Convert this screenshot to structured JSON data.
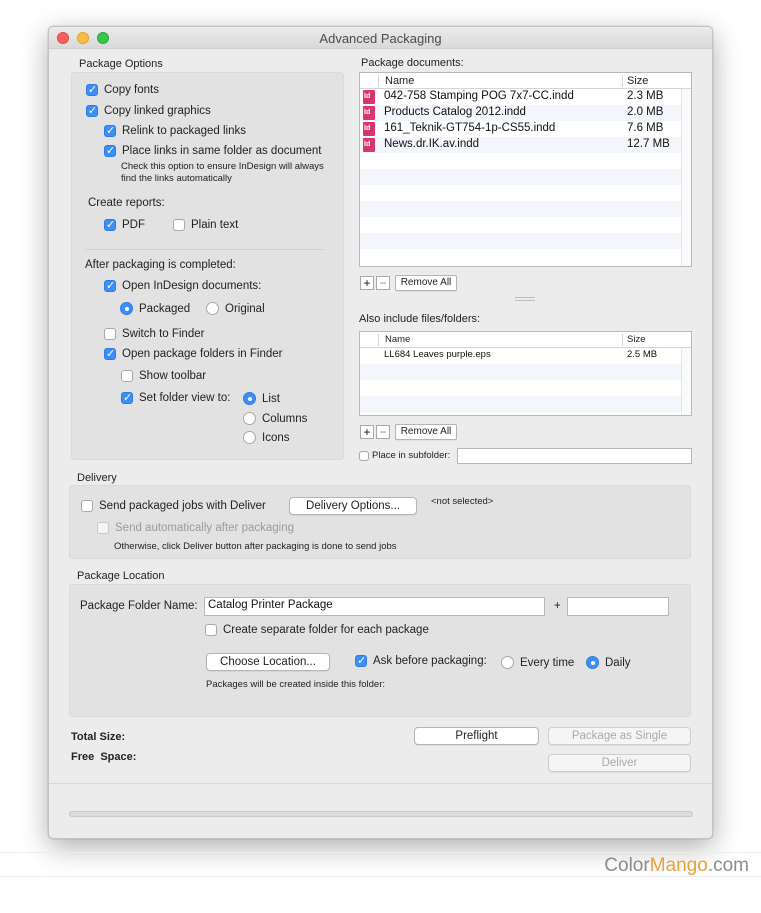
{
  "window": {
    "title": "Advanced Packaging"
  },
  "package_options": {
    "title": "Package Options",
    "copy_fonts": "Copy fonts",
    "copy_linked_graphics": "Copy linked graphics",
    "relink": "Relink to packaged links",
    "place_links": "Place links in same folder as document",
    "place_links_hint": "Check this option to ensure InDesign will always find the links automatically",
    "create_reports": "Create reports:",
    "pdf": "PDF",
    "plain_text": "Plain text",
    "after_packaging": "After packaging is completed:",
    "open_indesign_docs": "Open InDesign documents:",
    "packaged": "Packaged",
    "original": "Original",
    "switch_to_finder": "Switch to Finder",
    "open_package_folders": "Open package folders in Finder",
    "show_toolbar": "Show toolbar",
    "set_folder_view": "Set folder view to:",
    "view_list": "List",
    "view_columns": "Columns",
    "view_icons": "Icons"
  },
  "package_documents": {
    "title": "Package documents:",
    "col_name": "Name",
    "col_size": "Size",
    "rows": [
      {
        "name": "042-758 Stamping POG 7x7-CC.indd",
        "size": "2.3 MB"
      },
      {
        "name": "Products Catalog 2012.indd",
        "size": "2.0 MB"
      },
      {
        "name": "161_Teknik-GT754-1p-CS55.indd",
        "size": "7.6 MB"
      },
      {
        "name": "News.dr.IK.av.indd",
        "size": "12.7 MB"
      }
    ],
    "add_label": "+",
    "remove_label": "−",
    "remove_all": "Remove All"
  },
  "also_include": {
    "title": "Also include files/folders:",
    "col_name": "Name",
    "col_size": "Size",
    "rows": [
      {
        "name": "LL684 Leaves purple.eps",
        "size": "2.5 MB"
      }
    ],
    "add_label": "+",
    "remove_label": "−",
    "remove_all": "Remove All",
    "place_in_subfolder": "Place in subfolder:",
    "subfolder_value": ""
  },
  "delivery": {
    "title": "Delivery",
    "send_with_deliver": "Send packaged jobs with Deliver",
    "delivery_options_button": "Delivery Options...",
    "not_selected": "<not selected>",
    "send_automatically": "Send automatically after packaging",
    "otherwise_hint": "Otherwise, click Deliver button after packaging is done to send jobs"
  },
  "package_location": {
    "title": "Package Location",
    "folder_name_label": "Package Folder Name:",
    "folder_name_value": "Catalog Printer Package",
    "plus": "+",
    "suffix_value": "",
    "create_separate_folder": "Create separate folder for each package",
    "choose_location_button": "Choose Location...",
    "ask_before_packaging": "Ask before packaging:",
    "every_time": "Every time",
    "daily": "Daily",
    "inside_folder_hint": "Packages will be created inside this folder:"
  },
  "footer": {
    "total_size": "Total Size:",
    "free_space": "Free  Space:",
    "preflight_button": "Preflight",
    "package_single_button": "Package as Single",
    "deliver_button": "Deliver"
  },
  "watermark": {
    "brand_a": "Color",
    "brand_b": "Mango",
    "brand_c": ".com"
  },
  "colors": {
    "accent": "#3d8ef7",
    "close": "#fc605c",
    "minimize": "#fdbc40",
    "zoom": "#34c84a"
  }
}
